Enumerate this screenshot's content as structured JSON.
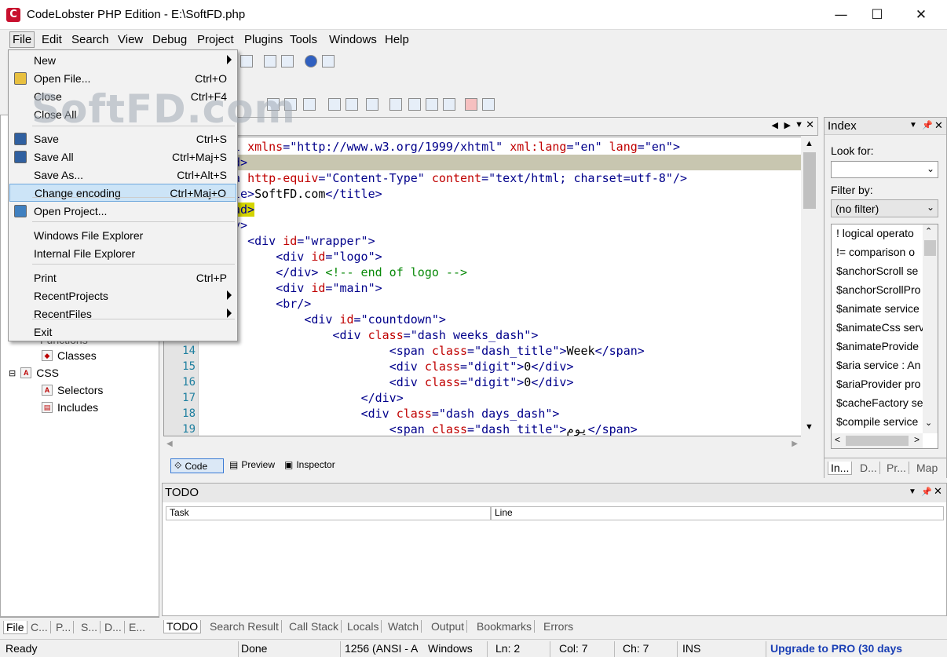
{
  "window": {
    "title": "CodeLobster PHP Edition - E:\\SoftFD.php",
    "minimize": "—",
    "maximize": "☐",
    "close": "✕"
  },
  "menubar": [
    "File",
    "Edit",
    "Search",
    "View",
    "Debug",
    "Project",
    "Plugins",
    "Tools",
    "Windows",
    "Help"
  ],
  "watermark": "SoftFD.com",
  "file_menu": {
    "items": [
      {
        "label": "New",
        "shortcut": "",
        "submenu": true
      },
      {
        "label": "Open File...",
        "shortcut": "Ctrl+O"
      },
      {
        "label": "Close",
        "shortcut": "Ctrl+F4"
      },
      {
        "label": "Close All",
        "shortcut": ""
      },
      {
        "label": "Save",
        "shortcut": "Ctrl+S"
      },
      {
        "label": "Save All",
        "shortcut": "Ctrl+Maj+S"
      },
      {
        "label": "Save As...",
        "shortcut": "Ctrl+Alt+S"
      },
      {
        "label": "Change encoding",
        "shortcut": "Ctrl+Maj+O",
        "highlighted": true
      },
      {
        "label": "Open Project...",
        "shortcut": ""
      },
      {
        "label": "Windows File Explorer",
        "shortcut": ""
      },
      {
        "label": "Internal File Explorer",
        "shortcut": ""
      },
      {
        "label": "Print",
        "shortcut": "Ctrl+P"
      },
      {
        "label": "RecentProjects",
        "shortcut": "",
        "submenu": true
      },
      {
        "label": "RecentFiles",
        "shortcut": "",
        "submenu": true
      },
      {
        "label": "Exit",
        "shortcut": ""
      }
    ]
  },
  "left_panel": {
    "tree": [
      {
        "label": "Functions",
        "partial": true
      },
      {
        "label": "Classes"
      },
      {
        "label": "CSS"
      },
      {
        "label": "Selectors"
      },
      {
        "label": "Includes"
      }
    ],
    "tabs": [
      "File",
      "C...",
      "P...",
      "S...",
      "D...",
      "E..."
    ]
  },
  "editor": {
    "lines": [
      {
        "n": "",
        "frag": [
          [
            "tag",
            "l "
          ],
          [
            "attr",
            "xmlns"
          ],
          [
            "tag",
            "="
          ],
          [
            "val",
            "\"http://www.w3.org/1999/xhtml\""
          ],
          [
            "tag",
            " "
          ],
          [
            "attr",
            "xml:lang"
          ],
          [
            "tag",
            "="
          ],
          [
            "val",
            "\"en\""
          ],
          [
            "tag",
            " "
          ],
          [
            "attr",
            "lang"
          ],
          [
            "tag",
            "="
          ],
          [
            "val",
            "\"en\""
          ],
          [
            "tag",
            ">"
          ]
        ]
      },
      {
        "n": "",
        "hl": "gray",
        "frag": [
          [
            "tag",
            "d>"
          ]
        ]
      },
      {
        "n": "",
        "frag": [
          [
            "tag",
            "a "
          ],
          [
            "attr",
            "http-equiv"
          ],
          [
            "tag",
            "="
          ],
          [
            "val",
            "\"Content-Type\""
          ],
          [
            "tag",
            " "
          ],
          [
            "attr",
            "content"
          ],
          [
            "tag",
            "="
          ],
          [
            "val",
            "\"text/html; charset=utf-8\""
          ],
          [
            "tag",
            "/>"
          ]
        ]
      },
      {
        "n": "",
        "frag": [
          [
            "tag",
            "le>"
          ],
          [
            "txt",
            "SoftFD.com"
          ],
          [
            "tag",
            "</title>"
          ]
        ]
      },
      {
        "n": "",
        "hl": "yellow",
        "frag": [
          [
            "tag",
            "ad>"
          ]
        ]
      },
      {
        "n": "",
        "frag": [
          [
            "tag",
            "y>"
          ]
        ]
      },
      {
        "n": "",
        "frag": [
          [
            "txt",
            "  "
          ],
          [
            "tag",
            "<div "
          ],
          [
            "attr",
            "id"
          ],
          [
            "tag",
            "="
          ],
          [
            "val",
            "\"wrapper\""
          ],
          [
            "tag",
            ">"
          ]
        ]
      },
      {
        "n": "",
        "frag": [
          [
            "txt",
            "      "
          ],
          [
            "tag",
            "<div "
          ],
          [
            "attr",
            "id"
          ],
          [
            "tag",
            "="
          ],
          [
            "val",
            "\"logo\""
          ],
          [
            "tag",
            ">"
          ]
        ]
      },
      {
        "n": "",
        "frag": [
          [
            "txt",
            "      "
          ],
          [
            "tag",
            "</div> "
          ],
          [
            "cmt",
            "<!-- end of logo -->"
          ]
        ]
      },
      {
        "n": "",
        "frag": [
          [
            "txt",
            "      "
          ],
          [
            "tag",
            "<div "
          ],
          [
            "attr",
            "id"
          ],
          [
            "tag",
            "="
          ],
          [
            "val",
            "\"main\""
          ],
          [
            "tag",
            ">"
          ]
        ]
      },
      {
        "n": "",
        "frag": [
          [
            "txt",
            "      "
          ],
          [
            "tag",
            "<br/>"
          ]
        ]
      },
      {
        "n": "",
        "frag": [
          [
            "txt",
            "          "
          ],
          [
            "tag",
            "<div "
          ],
          [
            "attr",
            "id"
          ],
          [
            "tag",
            "="
          ],
          [
            "val",
            "\"countdown\""
          ],
          [
            "tag",
            ">"
          ]
        ]
      },
      {
        "n": "",
        "frag": [
          [
            "txt",
            "              "
          ],
          [
            "tag",
            "<div "
          ],
          [
            "attr",
            "class"
          ],
          [
            "tag",
            "="
          ],
          [
            "val",
            "\"dash weeks_dash\""
          ],
          [
            "tag",
            ">"
          ]
        ]
      },
      {
        "n": "14",
        "frag": [
          [
            "txt",
            "                      "
          ],
          [
            "tag",
            "<span "
          ],
          [
            "attr",
            "class"
          ],
          [
            "tag",
            "="
          ],
          [
            "val",
            "\"dash_title\""
          ],
          [
            "tag",
            ">"
          ],
          [
            "txt",
            "Week"
          ],
          [
            "tag",
            "</span>"
          ]
        ]
      },
      {
        "n": "15",
        "frag": [
          [
            "txt",
            "                      "
          ],
          [
            "tag",
            "<div "
          ],
          [
            "attr",
            "class"
          ],
          [
            "tag",
            "="
          ],
          [
            "val",
            "\"digit\""
          ],
          [
            "tag",
            ">"
          ],
          [
            "txt",
            "0"
          ],
          [
            "tag",
            "</div>"
          ]
        ]
      },
      {
        "n": "16",
        "frag": [
          [
            "txt",
            "                      "
          ],
          [
            "tag",
            "<div "
          ],
          [
            "attr",
            "class"
          ],
          [
            "tag",
            "="
          ],
          [
            "val",
            "\"digit\""
          ],
          [
            "tag",
            ">"
          ],
          [
            "txt",
            "0"
          ],
          [
            "tag",
            "</div>"
          ]
        ]
      },
      {
        "n": "17",
        "frag": [
          [
            "txt",
            "                  "
          ],
          [
            "tag",
            "</div>"
          ]
        ]
      },
      {
        "n": "18",
        "frag": [
          [
            "txt",
            "                  "
          ],
          [
            "tag",
            "<div "
          ],
          [
            "attr",
            "class"
          ],
          [
            "tag",
            "="
          ],
          [
            "val",
            "\"dash days_dash\""
          ],
          [
            "tag",
            ">"
          ]
        ]
      },
      {
        "n": "19",
        "frag": [
          [
            "txt",
            "                      "
          ],
          [
            "tag",
            "<span "
          ],
          [
            "attr",
            "class"
          ],
          [
            "tag",
            "="
          ],
          [
            "val",
            "\"dash title\""
          ],
          [
            "tag",
            ">"
          ],
          [
            "txt",
            "يوم"
          ],
          [
            "tag",
            "</span>"
          ]
        ]
      }
    ],
    "view_tabs": [
      "Code",
      "Preview",
      "Inspector"
    ]
  },
  "index_panel": {
    "title": "Index",
    "look_for_label": "Look for:",
    "look_for_value": "",
    "filter_label": "Filter by:",
    "filter_value": "(no filter)",
    "items": [
      "! logical operato",
      "!= comparison o",
      "$anchorScroll se",
      "$anchorScrollPro",
      "$animate service",
      "$animateCss serv",
      "$animateProvide",
      "$aria service : An",
      "$ariaProvider pro",
      "$cacheFactory se",
      "$compile service"
    ],
    "tabs": [
      "In...",
      "D...",
      "Pr...",
      "Map"
    ]
  },
  "todo_panel": {
    "title": "TODO",
    "columns": [
      "Task",
      "Line"
    ]
  },
  "bottom_tabs": [
    "TODO",
    "Search Result",
    "Call Stack",
    "Locals",
    "Watch",
    "Output",
    "Bookmarks",
    "Errors"
  ],
  "status": {
    "ready": "Ready",
    "done": "Done",
    "encoding": "1256 (ANSI - A",
    "eol": "Windows",
    "ln": "Ln: 2",
    "col": "Col: 7",
    "ch": "Ch: 7",
    "mode": "INS",
    "upgrade": "Upgrade to PRO (30 days"
  }
}
